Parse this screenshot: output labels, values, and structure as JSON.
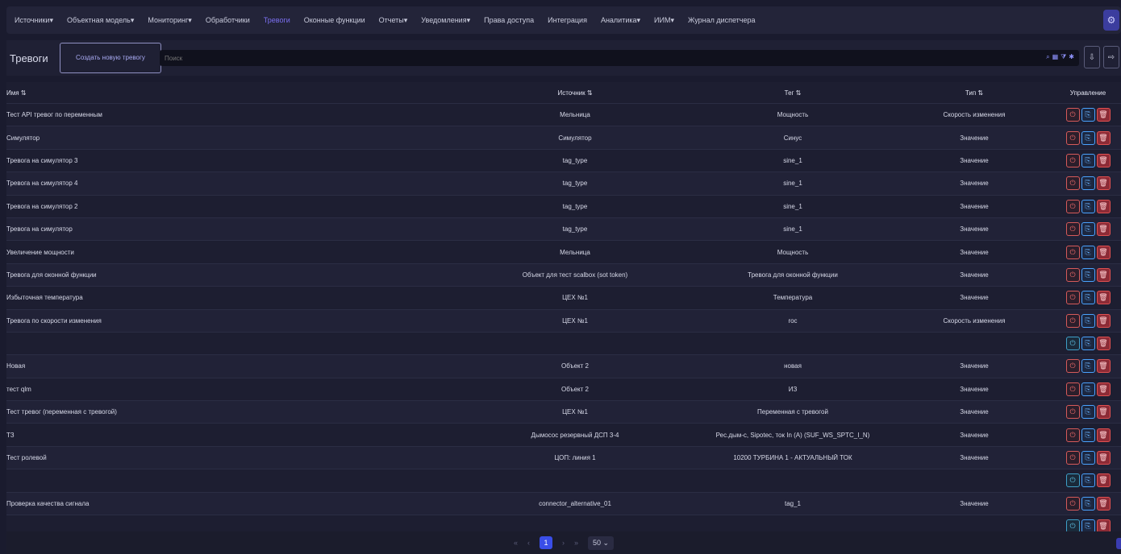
{
  "nav": {
    "items": [
      {
        "label": "Источники▾",
        "active": false
      },
      {
        "label": "Объектная модель▾",
        "active": false
      },
      {
        "label": "Мониторинг▾",
        "active": false
      },
      {
        "label": "Обработчики",
        "active": false
      },
      {
        "label": "Тревоги",
        "active": true
      },
      {
        "label": "Оконные функции",
        "active": false
      },
      {
        "label": "Отчеты▾",
        "active": false
      },
      {
        "label": "Уведомления▾",
        "active": false
      },
      {
        "label": "Права доступа",
        "active": false
      },
      {
        "label": "Интеграция",
        "active": false
      },
      {
        "label": "Аналитика▾",
        "active": false
      },
      {
        "label": "ИИМ▾",
        "active": false
      },
      {
        "label": "Журнал диспетчера",
        "active": false
      }
    ],
    "settings_icon": "gear-icon"
  },
  "toolbar": {
    "title": "Тревоги",
    "create_label": "Создать новую тревогу",
    "search_placeholder": "Поиск"
  },
  "table": {
    "headers": {
      "name": "Имя ⇅",
      "source": "Источник ⇅",
      "tag": "Тег ⇅",
      "type": "Тип ⇅",
      "controls": "Управление"
    },
    "rows": [
      {
        "name": "Тест API тревог по переменным",
        "source": "Мельница",
        "tag": "Мощность",
        "type": "Скорость изменения",
        "dim": false
      },
      {
        "name": "Симулятор",
        "source": "Симулятор",
        "tag": "Синус",
        "type": "Значение",
        "dim": false
      },
      {
        "name": "Тревога на симулятор 3",
        "source": "tag_type",
        "tag": "sine_1",
        "type": "Значение",
        "dim": false
      },
      {
        "name": "Тревога на симулятор 4",
        "source": "tag_type",
        "tag": "sine_1",
        "type": "Значение",
        "dim": false
      },
      {
        "name": "Тревога на симулятор 2",
        "source": "tag_type",
        "tag": "sine_1",
        "type": "Значение",
        "dim": false
      },
      {
        "name": "Тревога на симулятор",
        "source": "tag_type",
        "tag": "sine_1",
        "type": "Значение",
        "dim": false
      },
      {
        "name": "Увеличение мощности",
        "source": "Мельница",
        "tag": "Мощность",
        "type": "Значение",
        "dim": false
      },
      {
        "name": "Тревога для оконной функции",
        "source": "Объект для тест scalbox (sot token)",
        "tag": "Тревога для оконной функции",
        "type": "Значение",
        "dim": false
      },
      {
        "name": "Избыточная температура",
        "source": "ЦЕХ №1",
        "tag": "Температура",
        "type": "Значение",
        "dim": false
      },
      {
        "name": "Тревога по скорости изменения",
        "source": "ЦЕХ №1",
        "tag": "roc",
        "type": "Скорость изменения",
        "dim": false
      },
      {
        "name": "",
        "source": "",
        "tag": "",
        "type": "",
        "dim": true
      },
      {
        "name": "Новая",
        "source": "Объект 2",
        "tag": "новая",
        "type": "Значение",
        "dim": false
      },
      {
        "name": "тест qlm",
        "source": "Объект 2",
        "tag": "ИЗ",
        "type": "Значение",
        "dim": false
      },
      {
        "name": "Тест тревог (переменная с тревогой)",
        "source": "ЦЕХ №1",
        "tag": "Переменная с тревогой",
        "type": "Значение",
        "dim": false
      },
      {
        "name": "ТЗ",
        "source": "Дымосос резервный ДСП 3-4",
        "tag": "Рес.дым-с, Sipotec, ток In (A) (SUF_WS_SPTC_I_N)",
        "type": "Значение",
        "dim": false
      },
      {
        "name": "Тест ролевой",
        "source": "ЦОП: линия 1",
        "tag": "10200 ТУРБИНА 1 - АКТУАЛЬНЫЙ ТОК",
        "type": "Значение",
        "dim": false
      },
      {
        "name": "",
        "source": "",
        "tag": "",
        "type": "",
        "dim": true
      },
      {
        "name": "Проверка качества сигнала",
        "source": "connector_alternative_01",
        "tag": "tag_1",
        "type": "Значение",
        "dim": false
      },
      {
        "name": "",
        "source": "",
        "tag": "",
        "type": "",
        "dim": true
      }
    ]
  },
  "pager": {
    "current": "1",
    "page_size": "50",
    "prev": "‹",
    "first": "«",
    "next": "›",
    "last": "»"
  }
}
